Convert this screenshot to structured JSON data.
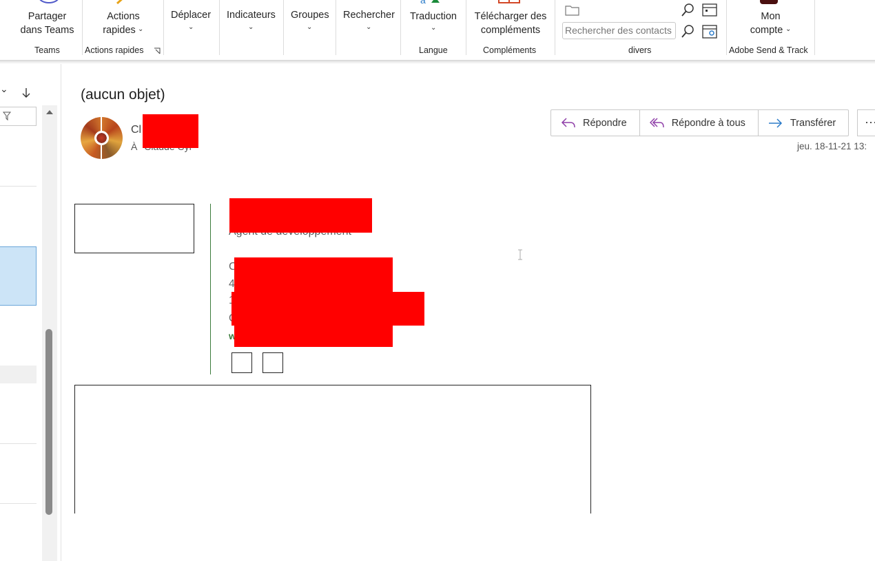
{
  "ribbon": {
    "teams": {
      "button_line1": "Partager",
      "button_line2": "dans Teams",
      "group": "Teams"
    },
    "quick_actions": {
      "button_line1": "Actions",
      "button_line2": "rapides",
      "group": "Actions rapides"
    },
    "move": {
      "label": "Déplacer"
    },
    "tags": {
      "label": "Indicateurs"
    },
    "groups": {
      "label": "Groupes"
    },
    "find": {
      "label": "Rechercher"
    },
    "translate": {
      "label": "Traduction",
      "group": "Langue"
    },
    "addins": {
      "button_line1": "Télécharger des",
      "button_line2": "compléments",
      "group": "Compléments"
    },
    "misc": {
      "search_placeholder": "Rechercher des contacts",
      "group": "divers"
    },
    "account": {
      "button_line1": "Mon",
      "button_line2": "compte",
      "group": "Adobe Send & Track"
    }
  },
  "message": {
    "subject": "(aucun objet)",
    "sender_visible": "Cl",
    "recipient_prefix": "À",
    "recipient_visible": "Claude Cyr",
    "date": "jeu. 18-11-21 13:",
    "actions": {
      "reply": "Répondre",
      "reply_all": "Répondre à tous",
      "forward": "Transférer",
      "more": "···"
    },
    "signature": {
      "title": "Agent de développement",
      "line1_initial": "C",
      "line2_initial": "4",
      "line3_initial": "1",
      "line4_initial": "C",
      "line5_initial": "w"
    }
  },
  "colors": {
    "accent_reply": "#8f3fa8",
    "accent_forward": "#2b7bc9",
    "redaction": "#ff0000",
    "signature_divider": "#3a7a3a",
    "selected_row": "#cce4f7"
  }
}
